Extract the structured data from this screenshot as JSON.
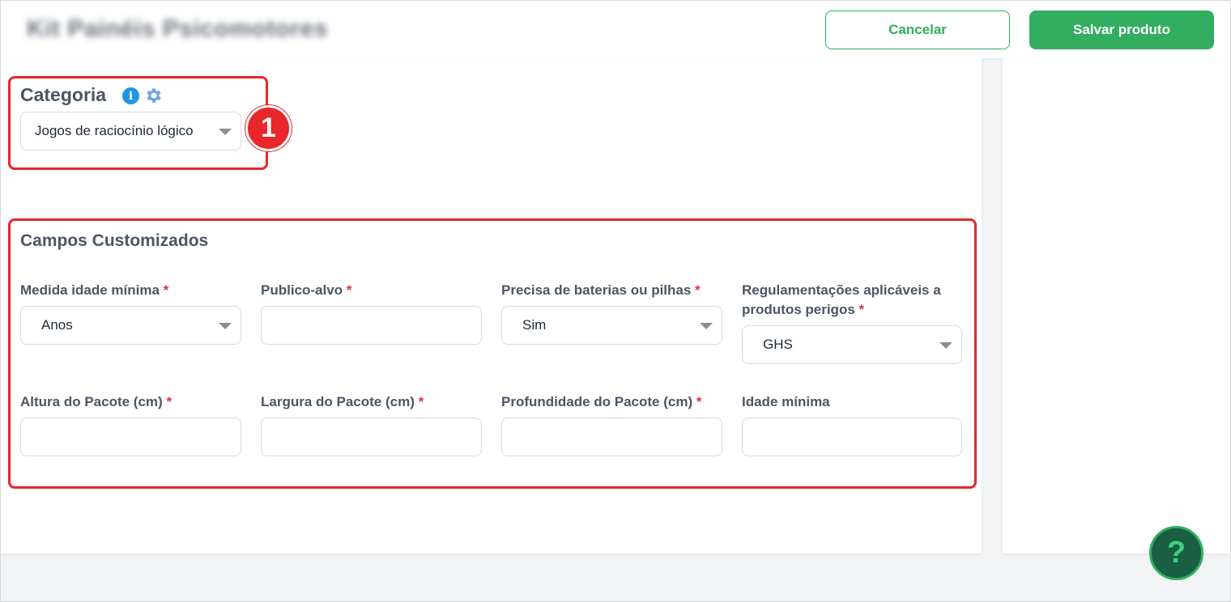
{
  "header": {
    "product_title": "Kit Painéis Psicomotores",
    "cancel_label": "Cancelar",
    "save_label": "Salvar produto"
  },
  "category": {
    "title": "Categoria",
    "info_icon": "info-icon",
    "settings_icon": "gear-icon",
    "selected": "Jogos de raciocínio lógico",
    "callout_number": "1"
  },
  "custom_fields": {
    "title": "Campos Customizados",
    "required_mark": "*",
    "fields": [
      {
        "label": "Medida idade mínima",
        "required": true,
        "type": "select",
        "value": "Anos"
      },
      {
        "label": "Publico-alvo",
        "required": true,
        "type": "input",
        "value": ""
      },
      {
        "label": "Precisa de baterias ou pilhas",
        "required": true,
        "type": "select",
        "value": "Sim"
      },
      {
        "label": "Regulamentações aplicáveis a produtos perigos",
        "required": true,
        "type": "select",
        "value": "GHS"
      },
      {
        "label": "Altura do Pacote (cm)",
        "required": true,
        "type": "input",
        "value": ""
      },
      {
        "label": "Largura do Pacote (cm)",
        "required": true,
        "type": "input",
        "value": ""
      },
      {
        "label": "Profundidade do Pacote (cm)",
        "required": true,
        "type": "input",
        "value": ""
      },
      {
        "label": "Idade mínima",
        "required": false,
        "type": "input",
        "value": ""
      }
    ]
  },
  "help": {
    "label": "?"
  },
  "colors": {
    "accent_green": "#33ad5f",
    "highlight_red": "#e8262b",
    "info_blue": "#1e96e0"
  }
}
